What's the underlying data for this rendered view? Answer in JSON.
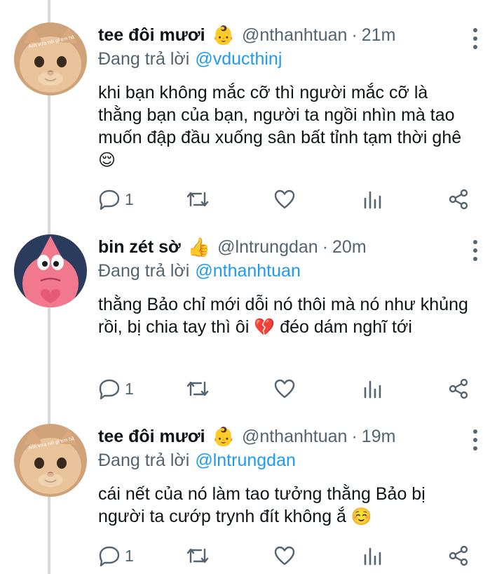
{
  "tweets": [
    {
      "name": "tee đôi mươi",
      "emoji": "👶",
      "handle": "@nthanhtuan",
      "separator": "·",
      "time": "21m",
      "reply_prefix": "Đang trả lời",
      "reply_to": "@vducthinj",
      "text": "khi bạn không mắc cỡ thì người mắc cỡ là thằng bạn của bạn, người ta ngồi nhìn mà tao muốn đập đầu xuống sân bất tỉnh tạm thời ghê",
      "text_emoji": "😌",
      "avatar": "cat-avatar",
      "avatar_caption": "Anh vừa nói gì em hả",
      "reply_count": "1"
    },
    {
      "name": "bin zét sờ",
      "emoji": "👍",
      "handle": "@lntrungdan",
      "separator": "·",
      "time": "20m",
      "reply_prefix": "Đang trả lời",
      "reply_to": "@nthanhtuan",
      "text_before": "thằng Bảo chỉ mới dỗi nó thôi mà nó như khủng rồi, bị chia tay thì ôi",
      "text_emoji": "💔",
      "text_after": "đéo dám nghĩ tới",
      "avatar": "patrick-avatar",
      "reply_count": "1"
    },
    {
      "name": "tee đôi mươi",
      "emoji": "👶",
      "handle": "@nthanhtuan",
      "separator": "·",
      "time": "19m",
      "reply_prefix": "Đang trả lời",
      "reply_to": "@lntrungdan",
      "text": "cái nết của nó làm tao tưởng thằng Bảo bị người ta cướp trynh đít không ắ",
      "text_emoji": "☺️",
      "avatar": "cat-avatar",
      "avatar_caption": "Anh vừa nói gì em hả",
      "reply_count": "1"
    }
  ],
  "icons": {
    "reply": "comment-icon",
    "retweet": "retweet-icon",
    "like": "heart-icon",
    "views": "analytics-icon",
    "share": "share-icon",
    "more": "more-vertical-icon"
  },
  "colors": {
    "link": "#1d9bf0",
    "secondary": "#536471",
    "text": "#0f1419",
    "thread_line": "#d9d9d9"
  }
}
